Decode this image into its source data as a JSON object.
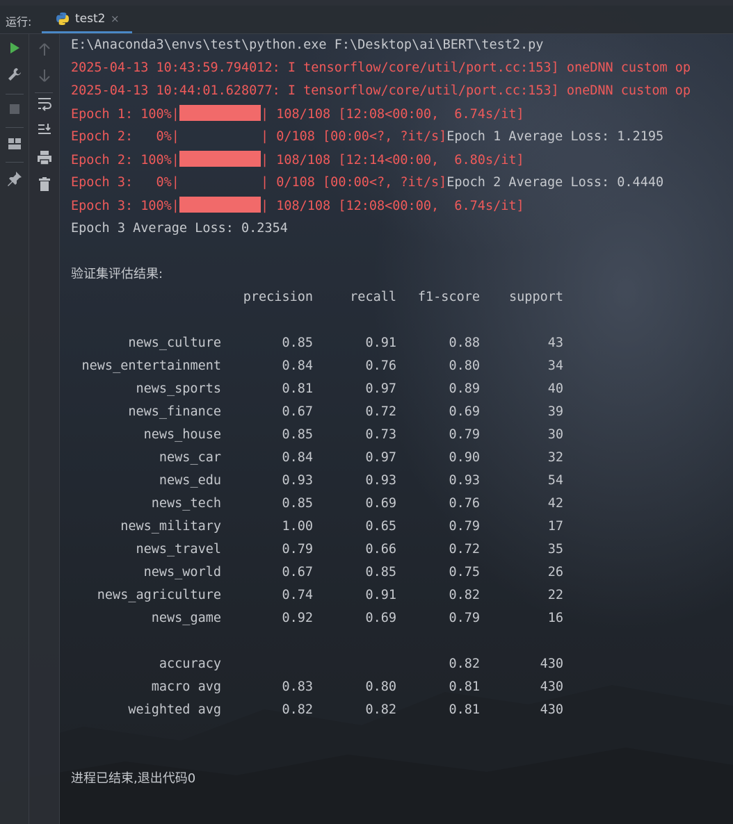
{
  "toolbar": {
    "run_label": "运行:",
    "tab_name": "test2",
    "tab_close": "×"
  },
  "console": {
    "command": "E:\\Anaconda3\\envs\\test\\python.exe F:\\Desktop\\ai\\BERT\\test2.py",
    "warnings": [
      "2025-04-13 10:43:59.794012: I tensorflow/core/util/port.cc:153] oneDNN custom op",
      "2025-04-13 10:44:01.628077: I tensorflow/core/util/port.cc:153] oneDNN custom op"
    ],
    "progress": [
      {
        "prefix": "Epoch 1: 100%|",
        "filled": true,
        "suffix": "| 108/108 [12:08<00:00,  6.74s/it]",
        "tail": ""
      },
      {
        "prefix": "Epoch 2:   0%|",
        "filled": false,
        "suffix": "| 0/108 [00:00<?, ?it/s]",
        "tail": "Epoch 1 Average Loss: 1.2195"
      },
      {
        "prefix": "Epoch 2: 100%|",
        "filled": true,
        "suffix": "| 108/108 [12:14<00:00,  6.80s/it]",
        "tail": ""
      },
      {
        "prefix": "Epoch 3:   0%|",
        "filled": false,
        "suffix": "| 0/108 [00:00<?, ?it/s]",
        "tail": "Epoch 2 Average Loss: 0.4440"
      },
      {
        "prefix": "Epoch 3: 100%|",
        "filled": true,
        "suffix": "| 108/108 [12:08<00:00,  6.74s/it]",
        "tail": ""
      }
    ],
    "final_loss": "Epoch 3 Average Loss: 0.2354",
    "eval_title": "验证集评估结果:",
    "headers": [
      "precision",
      "recall",
      "f1-score",
      "support"
    ],
    "rows": [
      [
        "news_culture",
        "0.85",
        "0.91",
        "0.88",
        "43"
      ],
      [
        "news_entertainment",
        "0.84",
        "0.76",
        "0.80",
        "34"
      ],
      [
        "news_sports",
        "0.81",
        "0.97",
        "0.89",
        "40"
      ],
      [
        "news_finance",
        "0.67",
        "0.72",
        "0.69",
        "39"
      ],
      [
        "news_house",
        "0.85",
        "0.73",
        "0.79",
        "30"
      ],
      [
        "news_car",
        "0.84",
        "0.97",
        "0.90",
        "32"
      ],
      [
        "news_edu",
        "0.93",
        "0.93",
        "0.93",
        "54"
      ],
      [
        "news_tech",
        "0.85",
        "0.69",
        "0.76",
        "42"
      ],
      [
        "news_military",
        "1.00",
        "0.65",
        "0.79",
        "17"
      ],
      [
        "news_travel",
        "0.79",
        "0.66",
        "0.72",
        "35"
      ],
      [
        "news_world",
        "0.67",
        "0.85",
        "0.75",
        "26"
      ],
      [
        "news_agriculture",
        "0.74",
        "0.91",
        "0.82",
        "22"
      ],
      [
        "news_game",
        "0.92",
        "0.69",
        "0.79",
        "16"
      ]
    ],
    "summary": [
      [
        "accuracy",
        "",
        "",
        "0.82",
        "430"
      ],
      [
        "macro avg",
        "0.83",
        "0.80",
        "0.81",
        "430"
      ],
      [
        "weighted avg",
        "0.82",
        "0.82",
        "0.81",
        "430"
      ]
    ],
    "exit_message": "进程已结束,退出代码0"
  },
  "colors": {
    "error_text": "#ef5a5a",
    "progress_bar": "#f16a6a",
    "run_icon": "#4caf50",
    "tab_underline": "#4a88c7"
  },
  "icons": {
    "toolbar_left": [
      "run-icon",
      "wrench-icon",
      "stop-icon",
      "layout-icon",
      "pin-icon"
    ],
    "toolbar_right": [
      "up-arrow-icon",
      "down-arrow-icon",
      "soft-wrap-icon",
      "scroll-to-end-icon",
      "print-icon",
      "trash-icon"
    ]
  }
}
